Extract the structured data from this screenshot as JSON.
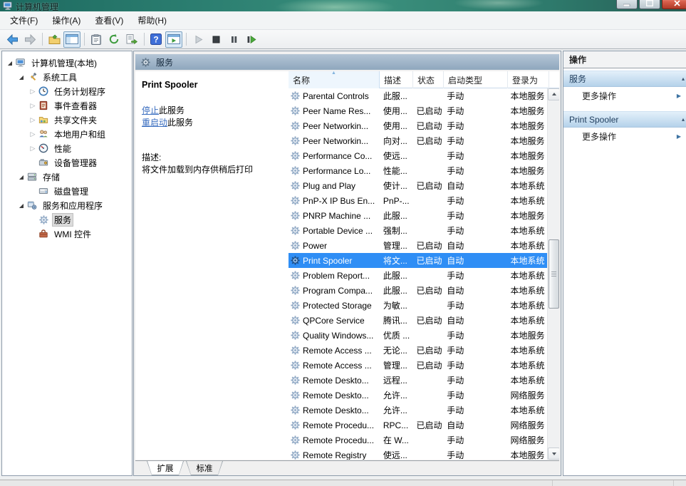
{
  "window": {
    "title": "计算机管理"
  },
  "menu": {
    "items": [
      "文件(F)",
      "操作(A)",
      "查看(V)",
      "帮助(H)"
    ]
  },
  "toolbar": {
    "buttons": [
      "back",
      "forward",
      "export-folder",
      "show-console-tree",
      "properties",
      "refresh",
      "export-list",
      "help",
      "show-action-pane",
      "start-service",
      "stop-service",
      "pause-service",
      "restart-service"
    ]
  },
  "icons": {
    "expanded_arrow": "◢",
    "collapsed_arrow": "▷",
    "sort_ascending": "▲",
    "more_actions_arrow": "▶",
    "section_arrow": "▴",
    "help_glyph": "?"
  },
  "tree": {
    "items": [
      {
        "key": "computer-management",
        "label": "计算机管理(本地)",
        "depth": 0,
        "expand": "expanded",
        "icon": "computer",
        "selected": false
      },
      {
        "key": "system-tools",
        "label": "系统工具",
        "depth": 1,
        "expand": "expanded",
        "icon": "tools",
        "selected": false
      },
      {
        "key": "task-scheduler",
        "label": "任务计划程序",
        "depth": 2,
        "expand": "collapsed",
        "icon": "clock",
        "selected": false
      },
      {
        "key": "event-viewer",
        "label": "事件查看器",
        "depth": 2,
        "expand": "collapsed",
        "icon": "eventlog",
        "selected": false
      },
      {
        "key": "shared-folders",
        "label": "共享文件夹",
        "depth": 2,
        "expand": "collapsed",
        "icon": "sharedfolder",
        "selected": false
      },
      {
        "key": "local-users-and-groups",
        "label": "本地用户和组",
        "depth": 2,
        "expand": "collapsed",
        "icon": "users",
        "selected": false
      },
      {
        "key": "performance",
        "label": "性能",
        "depth": 2,
        "expand": "collapsed",
        "icon": "performance",
        "selected": false
      },
      {
        "key": "device-manager",
        "label": "设备管理器",
        "depth": 2,
        "expand": "none",
        "icon": "devicemgr",
        "selected": false
      },
      {
        "key": "storage",
        "label": "存储",
        "depth": 1,
        "expand": "expanded",
        "icon": "storage",
        "selected": false
      },
      {
        "key": "disk-management",
        "label": "磁盘管理",
        "depth": 2,
        "expand": "none",
        "icon": "disk",
        "selected": false
      },
      {
        "key": "services-and-applications",
        "label": "服务和应用程序",
        "depth": 1,
        "expand": "expanded",
        "icon": "svcapps",
        "selected": false
      },
      {
        "key": "services",
        "label": "服务",
        "depth": 2,
        "expand": "none",
        "icon": "gear",
        "selected": true
      },
      {
        "key": "wmi-control",
        "label": "WMI 控件",
        "depth": 2,
        "expand": "none",
        "icon": "wmi",
        "selected": false
      }
    ]
  },
  "middle": {
    "header": "服务",
    "extended": {
      "service_name": "Print Spooler",
      "stop_link": "停止",
      "stop_suffix": "此服务",
      "restart_link": "重启动",
      "restart_suffix": "此服务",
      "description_label": "描述:",
      "description": "将文件加载到内存供稍后打印"
    },
    "tabs": [
      {
        "label": "扩展",
        "active": true
      },
      {
        "label": "标准",
        "active": false
      }
    ]
  },
  "services": {
    "columns": [
      "名称",
      "描述",
      "状态",
      "启动类型",
      "登录为"
    ],
    "rows": [
      {
        "name": "Parental Controls",
        "desc": "此服...",
        "status": "",
        "startup": "手动",
        "logon": "本地服务",
        "selected": false
      },
      {
        "name": "Peer Name Res...",
        "desc": "使用...",
        "status": "已启动",
        "startup": "手动",
        "logon": "本地服务",
        "selected": false
      },
      {
        "name": "Peer Networkin...",
        "desc": "使用...",
        "status": "已启动",
        "startup": "手动",
        "logon": "本地服务",
        "selected": false
      },
      {
        "name": "Peer Networkin...",
        "desc": "向对...",
        "status": "已启动",
        "startup": "手动",
        "logon": "本地服务",
        "selected": false
      },
      {
        "name": "Performance Co...",
        "desc": "使远...",
        "status": "",
        "startup": "手动",
        "logon": "本地服务",
        "selected": false
      },
      {
        "name": "Performance Lo...",
        "desc": "性能...",
        "status": "",
        "startup": "手动",
        "logon": "本地服务",
        "selected": false
      },
      {
        "name": "Plug and Play",
        "desc": "使计...",
        "status": "已启动",
        "startup": "自动",
        "logon": "本地系统",
        "selected": false
      },
      {
        "name": "PnP-X IP Bus En...",
        "desc": "PnP-...",
        "status": "",
        "startup": "手动",
        "logon": "本地系统",
        "selected": false
      },
      {
        "name": "PNRP Machine ...",
        "desc": "此服...",
        "status": "",
        "startup": "手动",
        "logon": "本地服务",
        "selected": false
      },
      {
        "name": "Portable Device ...",
        "desc": "强制...",
        "status": "",
        "startup": "手动",
        "logon": "本地系统",
        "selected": false
      },
      {
        "name": "Power",
        "desc": "管理...",
        "status": "已启动",
        "startup": "自动",
        "logon": "本地系统",
        "selected": false
      },
      {
        "name": "Print Spooler",
        "desc": "将文...",
        "status": "已启动",
        "startup": "自动",
        "logon": "本地系统",
        "selected": true
      },
      {
        "name": "Problem Report...",
        "desc": "此服...",
        "status": "",
        "startup": "手动",
        "logon": "本地系统",
        "selected": false
      },
      {
        "name": "Program Compa...",
        "desc": "此服...",
        "status": "已启动",
        "startup": "自动",
        "logon": "本地系统",
        "selected": false
      },
      {
        "name": "Protected Storage",
        "desc": "为敏...",
        "status": "",
        "startup": "手动",
        "logon": "本地系统",
        "selected": false
      },
      {
        "name": "QPCore Service",
        "desc": "腾讯...",
        "status": "已启动",
        "startup": "自动",
        "logon": "本地系统",
        "selected": false
      },
      {
        "name": "Quality Windows...",
        "desc": "优质 ...",
        "status": "",
        "startup": "手动",
        "logon": "本地服务",
        "selected": false
      },
      {
        "name": "Remote Access ...",
        "desc": "无论...",
        "status": "已启动",
        "startup": "手动",
        "logon": "本地系统",
        "selected": false
      },
      {
        "name": "Remote Access ...",
        "desc": "管理...",
        "status": "已启动",
        "startup": "手动",
        "logon": "本地系统",
        "selected": false
      },
      {
        "name": "Remote Deskto...",
        "desc": "远程...",
        "status": "",
        "startup": "手动",
        "logon": "本地系统",
        "selected": false
      },
      {
        "name": "Remote Deskto...",
        "desc": "允许...",
        "status": "",
        "startup": "手动",
        "logon": "网络服务",
        "selected": false
      },
      {
        "name": "Remote Deskto...",
        "desc": "允许...",
        "status": "",
        "startup": "手动",
        "logon": "本地系统",
        "selected": false
      },
      {
        "name": "Remote Procedu...",
        "desc": "RPC...",
        "status": "已启动",
        "startup": "自动",
        "logon": "网络服务",
        "selected": false
      },
      {
        "name": "Remote Procedu...",
        "desc": "在 W...",
        "status": "",
        "startup": "手动",
        "logon": "网络服务",
        "selected": false
      },
      {
        "name": "Remote Registry",
        "desc": "使远...",
        "status": "",
        "startup": "手动",
        "logon": "本地服务",
        "selected": false
      }
    ]
  },
  "actions": {
    "title": "操作",
    "sections": [
      {
        "title": "服务",
        "items": [
          "更多操作"
        ]
      },
      {
        "title": "Print Spooler",
        "items": [
          "更多操作"
        ]
      }
    ]
  }
}
